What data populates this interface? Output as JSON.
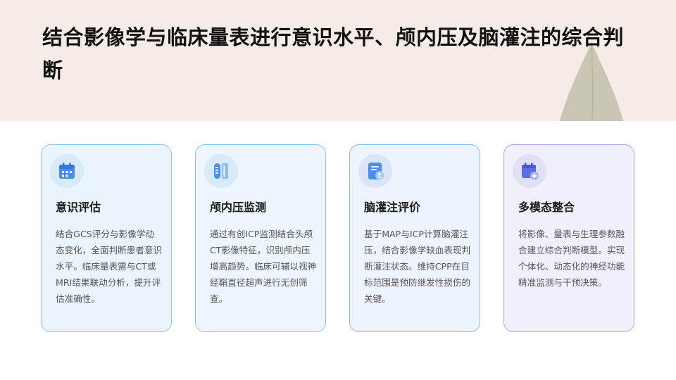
{
  "page": {
    "title": "结合影像学与临床量表进行意识水平、颅内压及脑灌注的综合判断"
  },
  "colors": {
    "header_background": "#f6ece7",
    "leaf": "#c9c6b4",
    "icon_blue": "#4a8df0",
    "icon_indigo": "#5b6fe0"
  },
  "cards": [
    {
      "icon": "calendar-icon",
      "title": "意识评估",
      "body": "结合GCS评分与影像学动态变化，全面判断患者意识水平。临床量表需与CT或MRI结果联动分析，提升评估准确性。"
    },
    {
      "icon": "gauge-bars-icon",
      "title": "颅内压监测",
      "body": "通过有创ICP监测结合头颅CT影像特征，识别颅内压增高趋势。临床可辅以视神经鞘直径超声进行无创筛查。"
    },
    {
      "icon": "document-user-icon",
      "title": "脑灌注评价",
      "body": "基于MAP与ICP计算脑灌注压，结合影像学缺血表现判断灌注状态。维持CPP在目标范围是预防继发性损伤的关键。"
    },
    {
      "icon": "calendar-add-icon",
      "title": "多模态整合",
      "body": "将影像、量表与生理参数融合建立综合判断模型。实现个体化、动态化的神经功能精准监测与干预决策。"
    }
  ]
}
